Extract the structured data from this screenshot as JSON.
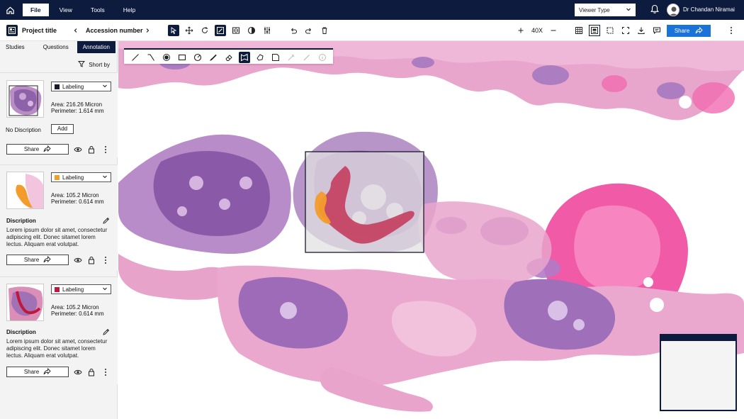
{
  "menu": {
    "items": [
      "File",
      "View",
      "Tools",
      "Help"
    ],
    "active": "File"
  },
  "viewer_type": {
    "label": "Viewer Type"
  },
  "user": {
    "name": "Dr Chandan Niramai"
  },
  "toolbar": {
    "project_title": "Project title",
    "accession_number": "Accession number",
    "zoom_level": "40X",
    "share_label": "Share"
  },
  "sidebar": {
    "tabs": [
      "Studies",
      "Questions",
      "Annotation"
    ],
    "active_tab": "Annotation",
    "sort_label": "Short by",
    "cards": [
      {
        "label": "Labeling",
        "color": "#1a1a2e",
        "area": "Area: 216.26 Micron",
        "perimeter": "Perimeter:  1.614 mm",
        "no_description": "No Discription",
        "add_label": "Add",
        "share_label": "Share"
      },
      {
        "label": "Labeling",
        "color": "#f39c2b",
        "area": "Area: 105.2 Micron",
        "perimeter": "Perimeter:  0.614 mm",
        "description_heading": "Discription",
        "description": "Lorem ipsum dolor sit amet, consectetur adipiscing elit. Donec sitamet lorem lectus. Aliquam erat volutpat.",
        "share_label": "Share"
      },
      {
        "label": "Labeling",
        "color": "#c0183a",
        "area": "Area: 105.2 Micron",
        "perimeter": "Perimeter:  0.614 mm",
        "description_heading": "Discription",
        "description": "Lorem ipsum dolor sit amet, consectetur adipiscing elit. Donec sitamet lorem lectus. Aliquam erat volutpat.",
        "share_label": "Share"
      }
    ]
  },
  "colors": {
    "navy": "#0d1b3e",
    "accent_blue": "#1a73d9",
    "tissue_pink": "#e88bc0",
    "tissue_purple": "#9a6bb5"
  }
}
